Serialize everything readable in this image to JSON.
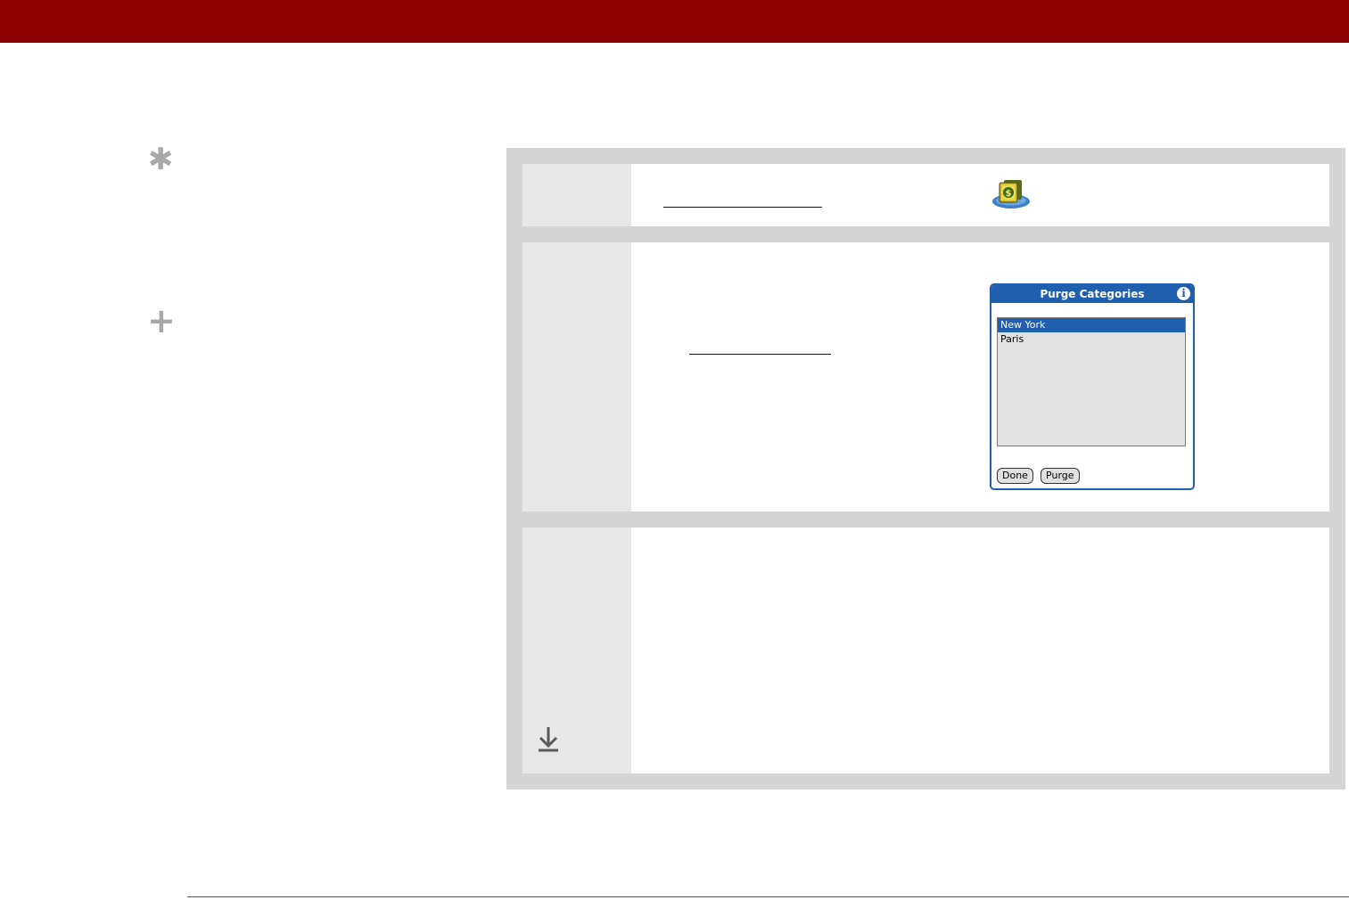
{
  "colors": {
    "header_bar": "#8b0000",
    "panel_bg": "#d5d5d5",
    "step_number_column": "#e8e8e8",
    "side_glyph": "#a8a8a8",
    "dialog_accent": "#1f5fae"
  },
  "sidebar": {
    "tip_glyph": "✱",
    "more_glyph": "+"
  },
  "steps": {
    "step1": {
      "app_icon": "expense-app-icon"
    },
    "step2": {
      "dialog": {
        "title": "Purge Categories",
        "info_glyph": "i",
        "items": [
          {
            "label": "New York",
            "selected": true
          },
          {
            "label": "Paris",
            "selected": false
          }
        ],
        "buttons": {
          "done": "Done",
          "purge": "Purge"
        }
      }
    },
    "step3": {
      "icon": "download-arrow-icon"
    }
  }
}
